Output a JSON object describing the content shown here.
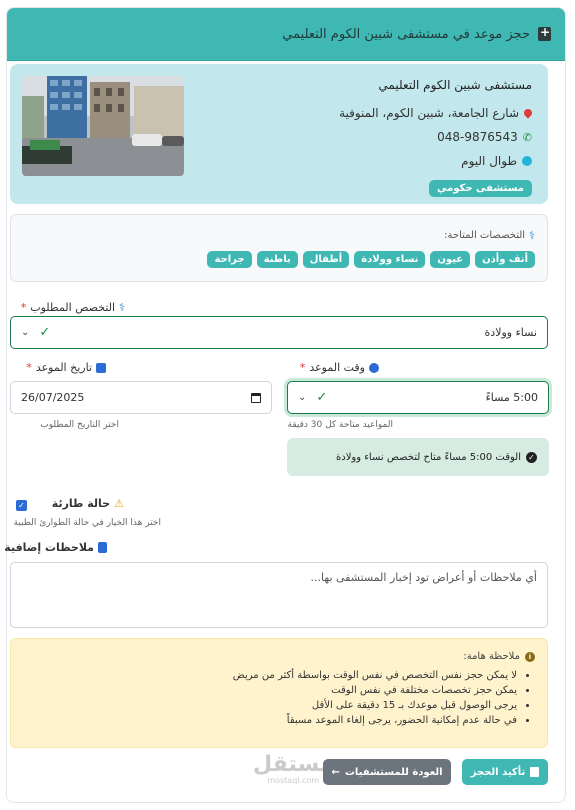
{
  "header": {
    "title": "حجز موعد في مستشفى شبين الكوم التعليمي"
  },
  "hospital": {
    "name": "مستشفى شبين الكوم التعليمي",
    "address": "شارع الجامعة، شبين الكوم، المنوفية",
    "phone": "048-9876543",
    "hours": "طوال اليوم",
    "type_badge": "مستشفى حكومي"
  },
  "specialties": {
    "title": "التخصصات المتاحة:",
    "items": [
      "أنف وأذن",
      "عيون",
      "نساء وولادة",
      "أطفال",
      "باطنة",
      "جراحة"
    ]
  },
  "specialty_field": {
    "label": "التخصص المطلوب",
    "required": "*",
    "value": "نساء وولادة"
  },
  "time_field": {
    "label": "وقت الموعد",
    "required": "*",
    "value": "5:00 مساءً",
    "hint": "المواعيد متاحة كل 30 دقيقة"
  },
  "date_field": {
    "label": "تاريخ الموعد",
    "required": "*",
    "value": "26/07/2025",
    "hint": "اختر التاريخ المطلوب"
  },
  "availability": {
    "message": "الوقت 5:00 مساءً متاح لتخصص نساء وولادة"
  },
  "emergency": {
    "label": "حالة طارئة",
    "hint": "اختر هذا الخيار في حالة الطوارئ الطبية",
    "checked": true
  },
  "notes": {
    "label": "ملاحظات إضافية",
    "placeholder": "أي ملاحظات أو أعراض تود إخبار المستشفى بها..."
  },
  "important": {
    "title": "ملاحظة هامة:",
    "items": [
      "لا يمكن حجز نفس التخصص في نفس الوقت بواسطة أكثر من مريض",
      "يمكن حجز تخصصات مختلفة في نفس الوقت",
      "يرجى الوصول قبل موعدك بـ 15 دقيقة على الأقل",
      "في حالة عدم إمكانية الحضور، يرجى إلغاء الموعد مسبقاً"
    ]
  },
  "actions": {
    "confirm": "تأكيد الحجز",
    "back": "العودة للمستشفيات"
  },
  "watermark": {
    "arabic": "مستقل",
    "latin": "mostaql.com"
  },
  "colors": {
    "accent": "#3fb8b4",
    "info_bg": "#c2e7ec",
    "alert_bg": "#fef3cd",
    "success_bg": "#d6ebe1"
  }
}
